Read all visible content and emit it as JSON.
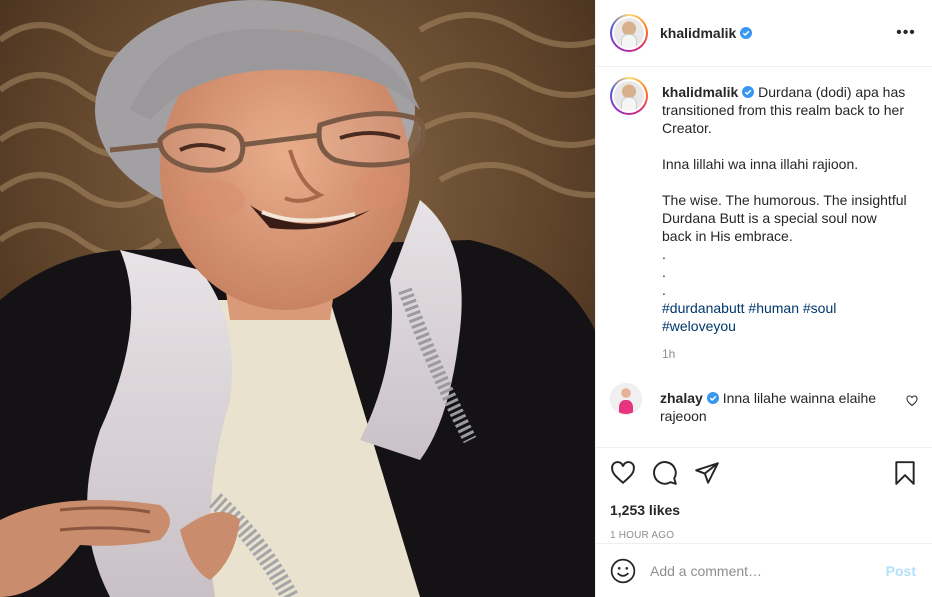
{
  "post": {
    "author": "khalidmalik",
    "caption_lines": [
      "Durdana (dodi) apa has",
      "transitioned from this realm back to her",
      "Creator.",
      "",
      "Inna lillahi wa inna illahi rajioon.",
      "",
      "The wise. The humorous. The insightful",
      "Durdana Butt is a special soul now",
      "back in His embrace.",
      ".",
      ".",
      "."
    ],
    "hashtags_line1": "#durdanabutt #human #soul",
    "hashtags_line2": "#weloveyou",
    "caption_time": "1h",
    "likes": "1,253 likes",
    "posted_ago": "1 HOUR AGO"
  },
  "comment": {
    "author": "zhalay",
    "text": "Inna lilahe wainna elaihe rajeoon"
  },
  "add_comment": {
    "placeholder": "Add a comment…",
    "post_label": "Post"
  },
  "colors": {
    "verified": "#3897f0",
    "hashtag": "#00376b",
    "muted": "#8e8e8e",
    "post_disabled": "#b2dffc"
  },
  "icons": [
    "more-icon",
    "verified-badge-icon",
    "like-heart-icon",
    "comment-icon",
    "share-icon",
    "save-bookmark-icon",
    "emoji-icon",
    "comment-like-icon"
  ]
}
